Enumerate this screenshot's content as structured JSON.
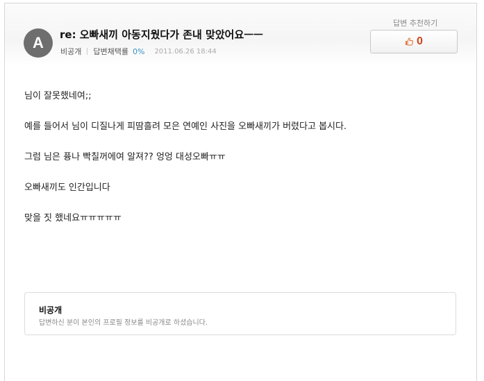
{
  "header": {
    "avatar_letter": "A",
    "title": "re: 오빠새끼 아동지웠다가 존내 맞았어요ㅡㅡ",
    "author": "비공개",
    "adoption_label": "답변채택률",
    "adoption_rate": "0%",
    "date": "2011.06.26 18:44"
  },
  "recommend": {
    "label": "답변 추천하기",
    "count": "0",
    "icon": "thumbs-up-icon"
  },
  "body": {
    "lines": [
      "님이 잘못했네여;;",
      "예를 들어서 님이 디질나게 피땀흘려 모은 연예인 사진을 오빠새끼가 버렸다고 봅시다.",
      "그럼 님은 퓽나 빡칠꺼에여 알져?? 엉엉 대성오빠ㅠㅠ",
      "오빠새끼도 인간입니다",
      "맞을 짓 했네요ㅠㅠㅠㅠㅠ"
    ]
  },
  "notice": {
    "title": "비공개",
    "text": "답변하신 분이 본인의 프로필 정보를 비공개로 하셨습니다."
  },
  "colors": {
    "accent": "#3a8fc7",
    "count": "#d2441e"
  }
}
